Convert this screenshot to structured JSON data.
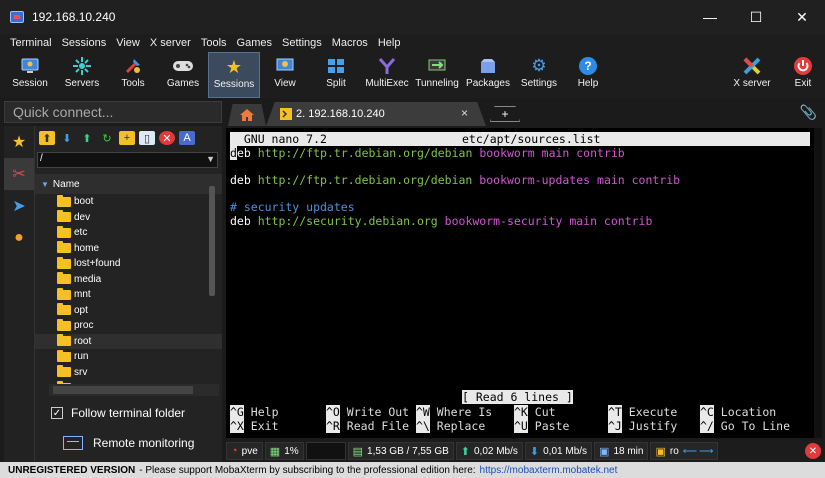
{
  "window": {
    "title": "192.168.10.240",
    "minimize": "—",
    "maximize": "☐",
    "close": "✕"
  },
  "menu": [
    "Terminal",
    "Sessions",
    "View",
    "X server",
    "Tools",
    "Games",
    "Settings",
    "Macros",
    "Help"
  ],
  "toolbar": {
    "session": "Session",
    "servers": "Servers",
    "tools": "Tools",
    "games": "Games",
    "sessions": "Sessions",
    "view": "View",
    "split": "Split",
    "multiexec": "MultiExec",
    "tunneling": "Tunneling",
    "packages": "Packages",
    "settings": "Settings",
    "help": "Help",
    "xserver": "X server",
    "exit": "Exit"
  },
  "quick_connect": {
    "placeholder": "Quick connect..."
  },
  "tabs": {
    "session_tab": "2. 192.168.10.240",
    "close": "×",
    "new_tab": "+"
  },
  "file_browser": {
    "path": "/",
    "column_header": "Name",
    "items": [
      "boot",
      "dev",
      "etc",
      "home",
      "lost+found",
      "media",
      "mnt",
      "opt",
      "proc",
      "root",
      "run",
      "srv"
    ],
    "follow_label": "Follow terminal folder",
    "remote_label": "Remote monitoring"
  },
  "terminal": {
    "header_left": "  GNU nano 7.2",
    "header_file": "etc/apt/sources.list",
    "line1_cursor": "d",
    "line1_deb": "eb",
    "line1_url": "http://ftp.tr.debian.org/debian",
    "line1_suite": "bookworm",
    "line1_comp": "main contrib",
    "line2_deb": "deb",
    "line2_url": "http://ftp.tr.debian.org/debian",
    "line2_suite": "bookworm-updates",
    "line2_comp": "main contrib",
    "comment": "# security updates",
    "line3_deb": "deb",
    "line3_url": "http://security.debian.org",
    "line3_suite": "bookworm-security",
    "line3_comp": "main contrib",
    "status_msg": "[ Read 6 lines ]",
    "shortcuts_row1": [
      {
        "key": "^G",
        "label": "Help"
      },
      {
        "key": "^O",
        "label": "Write Out"
      },
      {
        "key": "^W",
        "label": "Where Is"
      },
      {
        "key": "^K",
        "label": "Cut"
      },
      {
        "key": "^T",
        "label": "Execute"
      },
      {
        "key": "^C",
        "label": "Location"
      }
    ],
    "shortcuts_row2": [
      {
        "key": "^X",
        "label": "Exit"
      },
      {
        "key": "^R",
        "label": "Read File"
      },
      {
        "key": "^\\",
        "label": "Replace"
      },
      {
        "key": "^U",
        "label": "Paste"
      },
      {
        "key": "^J",
        "label": "Justify"
      },
      {
        "key": "^/",
        "label": "Go To Line"
      }
    ]
  },
  "statusbar": {
    "host": "pve",
    "cpu": "1%",
    "memory": "1,53 GB / 7,55 GB",
    "upload": "0,02 Mb/s",
    "download": "0,01 Mb/s",
    "uptime": "18 min",
    "user": "ro"
  },
  "footer": {
    "unregistered": "UNREGISTERED VERSION",
    "message": "-  Please support MobaXterm by subscribing to the professional edition here:",
    "link": "https://mobaxterm.mobatek.net"
  },
  "colors": {
    "accent": "#3b4a5c",
    "folder": "#f5c023",
    "nano_green": "#7ec44a",
    "nano_magenta": "#d255d2",
    "nano_blue": "#4d8fd6"
  }
}
